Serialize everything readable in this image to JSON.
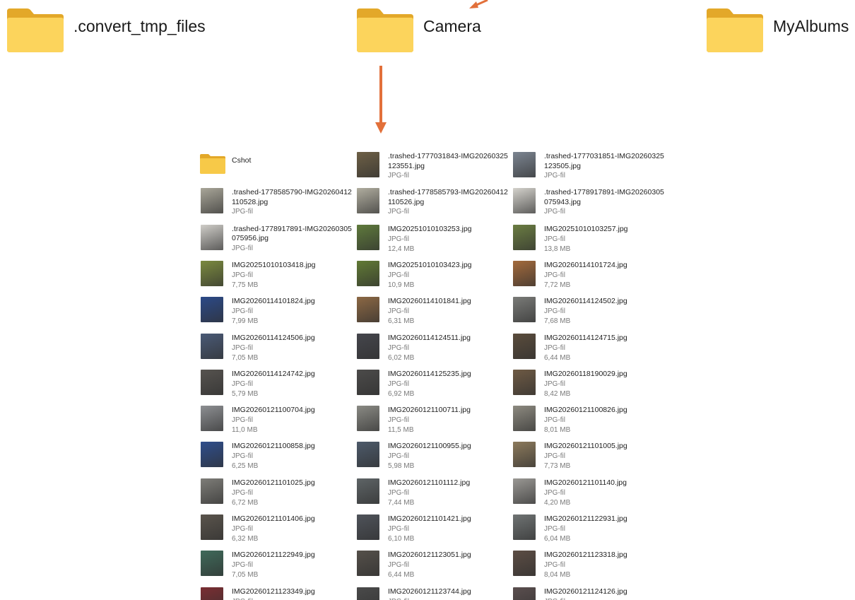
{
  "top_folders": [
    {
      "name": ".convert_tmp_files"
    },
    {
      "name": "Camera"
    },
    {
      "name": "MyAlbums"
    }
  ],
  "arrow_color": "#e2703a",
  "folder_color": "#f7c948",
  "files": [
    {
      "name": "Cshot",
      "kind": "folder"
    },
    {
      "name": ".trashed-1777031843-IMG20260325123551.jpg",
      "line1": ".trashed-1777031843-IMG20260325",
      "line2": "123551.jpg",
      "type": "JPG-fil",
      "thumb": "#6e6046"
    },
    {
      "name": ".trashed-1777031851-IMG20260325123505.jpg",
      "line1": ".trashed-1777031851-IMG20260325",
      "line2": "123505.jpg",
      "type": "JPG-fil",
      "thumb": "#7c8591"
    },
    {
      "name": ".trashed-1778585790-IMG20260412110528.jpg",
      "line1": ".trashed-1778585790-IMG20260412",
      "line2": "110528.jpg",
      "type": "JPG-fil",
      "thumb": "#a9a699"
    },
    {
      "name": ".trashed-1778585793-IMG20260412110526.jpg",
      "line1": ".trashed-1778585793-IMG20260412",
      "line2": "110526.jpg",
      "type": "JPG-fil",
      "thumb": "#b0ad9f"
    },
    {
      "name": ".trashed-1778917891-IMG20260305075943.jpg",
      "line1": ".trashed-1778917891-IMG20260305",
      "line2": "075943.jpg",
      "type": "JPG-fil",
      "thumb": "#d4d2cc"
    },
    {
      "name": ".trashed-1778917891-IMG20260305075956.jpg",
      "line1": ".trashed-1778917891-IMG20260305",
      "line2": "075956.jpg",
      "type": "JPG-fil",
      "thumb": "#cfcdc8"
    },
    {
      "name": "IMG20251010103253.jpg",
      "type": "JPG-fil",
      "size": "12,4 MB",
      "thumb": "#5f7a3c"
    },
    {
      "name": "IMG20251010103257.jpg",
      "type": "JPG-fil",
      "size": "13,8 MB",
      "thumb": "#6b7d42"
    },
    {
      "name": "IMG20251010103418.jpg",
      "type": "JPG-fil",
      "size": "7,75 MB",
      "thumb": "#7b8a3f"
    },
    {
      "name": "IMG20251010103423.jpg",
      "type": "JPG-fil",
      "size": "10,9 MB",
      "thumb": "#617a35"
    },
    {
      "name": "IMG20260114101724.jpg",
      "type": "JPG-fil",
      "size": "7,72 MB",
      "thumb": "#a36a3c"
    },
    {
      "name": "IMG20260114101824.jpg",
      "type": "JPG-fil",
      "size": "7,99 MB",
      "thumb": "#2c4a88"
    },
    {
      "name": "IMG20260114101841.jpg",
      "type": "JPG-fil",
      "size": "6,31 MB",
      "thumb": "#8c6844"
    },
    {
      "name": "IMG20260114124502.jpg",
      "type": "JPG-fil",
      "size": "7,68 MB",
      "thumb": "#7a7b78"
    },
    {
      "name": "IMG20260114124506.jpg",
      "type": "JPG-fil",
      "size": "7,05 MB",
      "thumb": "#4a5a76"
    },
    {
      "name": "IMG20260114124511.jpg",
      "type": "JPG-fil",
      "size": "6,02 MB",
      "thumb": "#45464c"
    },
    {
      "name": "IMG20260114124715.jpg",
      "type": "JPG-fil",
      "size": "6,44 MB",
      "thumb": "#5a4c3c"
    },
    {
      "name": "IMG20260114124742.jpg",
      "type": "JPG-fil",
      "size": "5,79 MB",
      "thumb": "#56534f"
    },
    {
      "name": "IMG20260114125235.jpg",
      "type": "JPG-fil",
      "size": "6,92 MB",
      "thumb": "#4c4b4a"
    },
    {
      "name": "IMG20260118190029.jpg",
      "type": "JPG-fil",
      "size": "8,42 MB",
      "thumb": "#6e5a44"
    },
    {
      "name": "IMG20260121100704.jpg",
      "type": "JPG-fil",
      "size": "11,0 MB",
      "thumb": "#8d8f92"
    },
    {
      "name": "IMG20260121100711.jpg",
      "type": "JPG-fil",
      "size": "11,5 MB",
      "thumb": "#8a8a84"
    },
    {
      "name": "IMG20260121100826.jpg",
      "type": "JPG-fil",
      "size": "8,01 MB",
      "thumb": "#8d8a80"
    },
    {
      "name": "IMG20260121100858.jpg",
      "type": "JPG-fil",
      "size": "6,25 MB",
      "thumb": "#2f4e8c"
    },
    {
      "name": "IMG20260121100955.jpg",
      "type": "JPG-fil",
      "size": "5,98 MB",
      "thumb": "#4d5a6a"
    },
    {
      "name": "IMG20260121101005.jpg",
      "type": "JPG-fil",
      "size": "7,73 MB",
      "thumb": "#8c7a5c"
    },
    {
      "name": "IMG20260121101025.jpg",
      "type": "JPG-fil",
      "size": "6,72 MB",
      "thumb": "#7e7d78"
    },
    {
      "name": "IMG20260121101112.jpg",
      "type": "JPG-fil",
      "size": "7,44 MB",
      "thumb": "#5e6466"
    },
    {
      "name": "IMG20260121101140.jpg",
      "type": "JPG-fil",
      "size": "4,20 MB",
      "thumb": "#9a9894"
    },
    {
      "name": "IMG20260121101406.jpg",
      "type": "JPG-fil",
      "size": "6,32 MB",
      "thumb": "#5a544c"
    },
    {
      "name": "IMG20260121101421.jpg",
      "type": "JPG-fil",
      "size": "6,10 MB",
      "thumb": "#4f535a"
    },
    {
      "name": "IMG20260121122931.jpg",
      "type": "JPG-fil",
      "size": "6,04 MB",
      "thumb": "#6f7373"
    },
    {
      "name": "IMG20260121122949.jpg",
      "type": "JPG-fil",
      "size": "7,05 MB",
      "thumb": "#3f6a5a"
    },
    {
      "name": "IMG20260121123051.jpg",
      "type": "JPG-fil",
      "size": "6,44 MB",
      "thumb": "#55504a"
    },
    {
      "name": "IMG20260121123318.jpg",
      "type": "JPG-fil",
      "size": "8,04 MB",
      "thumb": "#5c4d44"
    },
    {
      "name": "IMG20260121123349.jpg",
      "type": "JPG-fil",
      "thumb": "#7a2e32"
    },
    {
      "name": "IMG20260121123744.jpg",
      "type": "JPG-fil",
      "thumb": "#4a4a4a"
    },
    {
      "name": "IMG20260121124126.jpg",
      "type": "JPG-fil",
      "thumb": "#5a4e4e"
    }
  ]
}
